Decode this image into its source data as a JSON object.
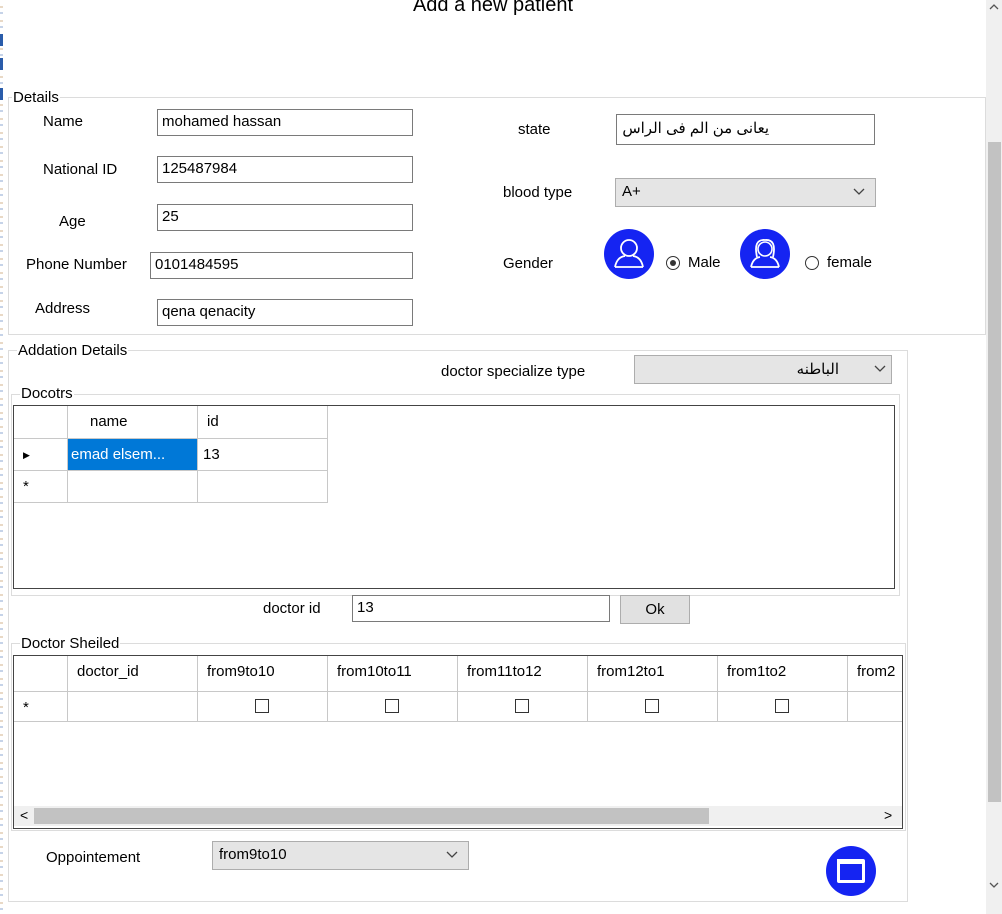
{
  "window": {
    "title": "Add a new patient"
  },
  "details": {
    "group_label": "Details",
    "name_label": "Name",
    "name_value": "mohamed hassan",
    "national_id_label": "National ID",
    "national_id_value": "125487984",
    "age_label": "Age",
    "age_value": "25",
    "phone_label": "Phone Number",
    "phone_value": "0101484595",
    "address_label": "Address",
    "address_value": "qena qenacity",
    "state_label": "state",
    "state_value": "يعانى من الم فى الراس",
    "blood_type_label": "blood type",
    "blood_type_value": "A+",
    "gender_label": "Gender",
    "gender_male": "Male",
    "gender_female": "female",
    "gender_selected": "Male",
    "icons": [
      "user-avatar-icon",
      "female-avatar-icon",
      "chevron-down-icon"
    ]
  },
  "additional": {
    "group_label": "Addation Details",
    "specialize_label": "doctor specialize type",
    "specialize_value": "الباطنه",
    "doctors_group_label": "Docotrs",
    "doctors_columns": [
      "name",
      "id"
    ],
    "doctors_rows": [
      {
        "name": "emad elsem...",
        "id": "13"
      }
    ],
    "row_pointer": "▶",
    "new_row_marker": "*",
    "doctor_id_label": "doctor id",
    "doctor_id_value": "13",
    "ok_label": "Ok",
    "schedule_group_label": "Doctor Sheiled",
    "schedule_columns": [
      "doctor_id",
      "from9to10",
      "from10to11",
      "from11to12",
      "from12to1",
      "from1to2",
      "from2"
    ],
    "scroll_left": "<",
    "scroll_right": ">",
    "appointment_label": "Oppointement",
    "appointment_value": "from9to10"
  },
  "colors": {
    "accent": "#0078d7",
    "avatar": "#1524f2",
    "save_icon": "#1524f2"
  }
}
